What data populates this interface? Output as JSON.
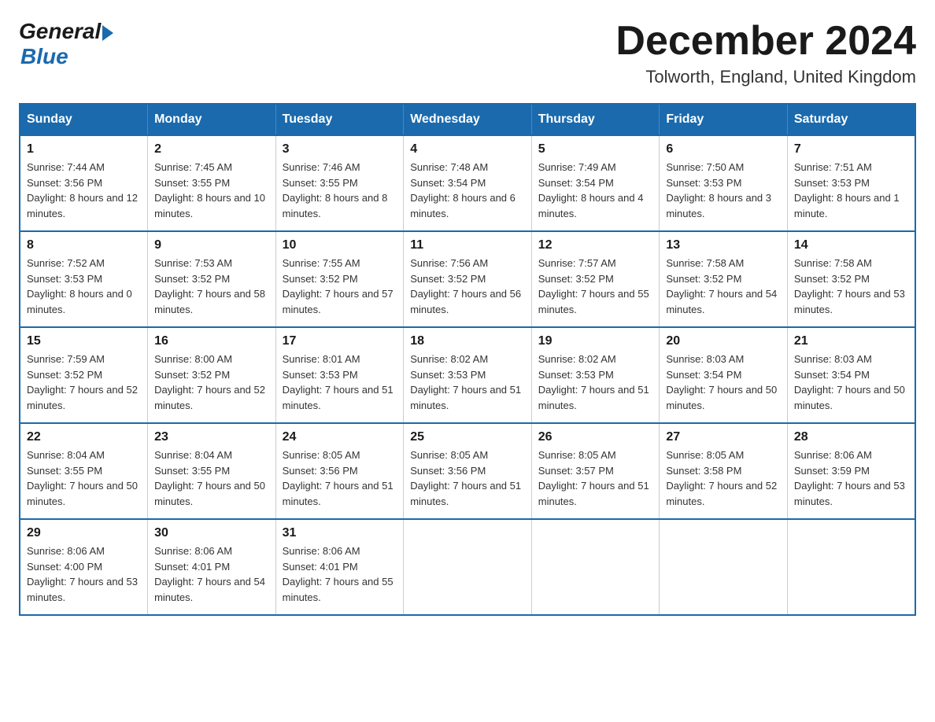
{
  "header": {
    "logo_general": "General",
    "logo_blue": "Blue",
    "month_title": "December 2024",
    "location": "Tolworth, England, United Kingdom"
  },
  "weekdays": [
    "Sunday",
    "Monday",
    "Tuesday",
    "Wednesday",
    "Thursday",
    "Friday",
    "Saturday"
  ],
  "weeks": [
    [
      {
        "day": "1",
        "sunrise": "7:44 AM",
        "sunset": "3:56 PM",
        "daylight": "8 hours and 12 minutes."
      },
      {
        "day": "2",
        "sunrise": "7:45 AM",
        "sunset": "3:55 PM",
        "daylight": "8 hours and 10 minutes."
      },
      {
        "day": "3",
        "sunrise": "7:46 AM",
        "sunset": "3:55 PM",
        "daylight": "8 hours and 8 minutes."
      },
      {
        "day": "4",
        "sunrise": "7:48 AM",
        "sunset": "3:54 PM",
        "daylight": "8 hours and 6 minutes."
      },
      {
        "day": "5",
        "sunrise": "7:49 AM",
        "sunset": "3:54 PM",
        "daylight": "8 hours and 4 minutes."
      },
      {
        "day": "6",
        "sunrise": "7:50 AM",
        "sunset": "3:53 PM",
        "daylight": "8 hours and 3 minutes."
      },
      {
        "day": "7",
        "sunrise": "7:51 AM",
        "sunset": "3:53 PM",
        "daylight": "8 hours and 1 minute."
      }
    ],
    [
      {
        "day": "8",
        "sunrise": "7:52 AM",
        "sunset": "3:53 PM",
        "daylight": "8 hours and 0 minutes."
      },
      {
        "day": "9",
        "sunrise": "7:53 AM",
        "sunset": "3:52 PM",
        "daylight": "7 hours and 58 minutes."
      },
      {
        "day": "10",
        "sunrise": "7:55 AM",
        "sunset": "3:52 PM",
        "daylight": "7 hours and 57 minutes."
      },
      {
        "day": "11",
        "sunrise": "7:56 AM",
        "sunset": "3:52 PM",
        "daylight": "7 hours and 56 minutes."
      },
      {
        "day": "12",
        "sunrise": "7:57 AM",
        "sunset": "3:52 PM",
        "daylight": "7 hours and 55 minutes."
      },
      {
        "day": "13",
        "sunrise": "7:58 AM",
        "sunset": "3:52 PM",
        "daylight": "7 hours and 54 minutes."
      },
      {
        "day": "14",
        "sunrise": "7:58 AM",
        "sunset": "3:52 PM",
        "daylight": "7 hours and 53 minutes."
      }
    ],
    [
      {
        "day": "15",
        "sunrise": "7:59 AM",
        "sunset": "3:52 PM",
        "daylight": "7 hours and 52 minutes."
      },
      {
        "day": "16",
        "sunrise": "8:00 AM",
        "sunset": "3:52 PM",
        "daylight": "7 hours and 52 minutes."
      },
      {
        "day": "17",
        "sunrise": "8:01 AM",
        "sunset": "3:53 PM",
        "daylight": "7 hours and 51 minutes."
      },
      {
        "day": "18",
        "sunrise": "8:02 AM",
        "sunset": "3:53 PM",
        "daylight": "7 hours and 51 minutes."
      },
      {
        "day": "19",
        "sunrise": "8:02 AM",
        "sunset": "3:53 PM",
        "daylight": "7 hours and 51 minutes."
      },
      {
        "day": "20",
        "sunrise": "8:03 AM",
        "sunset": "3:54 PM",
        "daylight": "7 hours and 50 minutes."
      },
      {
        "day": "21",
        "sunrise": "8:03 AM",
        "sunset": "3:54 PM",
        "daylight": "7 hours and 50 minutes."
      }
    ],
    [
      {
        "day": "22",
        "sunrise": "8:04 AM",
        "sunset": "3:55 PM",
        "daylight": "7 hours and 50 minutes."
      },
      {
        "day": "23",
        "sunrise": "8:04 AM",
        "sunset": "3:55 PM",
        "daylight": "7 hours and 50 minutes."
      },
      {
        "day": "24",
        "sunrise": "8:05 AM",
        "sunset": "3:56 PM",
        "daylight": "7 hours and 51 minutes."
      },
      {
        "day": "25",
        "sunrise": "8:05 AM",
        "sunset": "3:56 PM",
        "daylight": "7 hours and 51 minutes."
      },
      {
        "day": "26",
        "sunrise": "8:05 AM",
        "sunset": "3:57 PM",
        "daylight": "7 hours and 51 minutes."
      },
      {
        "day": "27",
        "sunrise": "8:05 AM",
        "sunset": "3:58 PM",
        "daylight": "7 hours and 52 minutes."
      },
      {
        "day": "28",
        "sunrise": "8:06 AM",
        "sunset": "3:59 PM",
        "daylight": "7 hours and 53 minutes."
      }
    ],
    [
      {
        "day": "29",
        "sunrise": "8:06 AM",
        "sunset": "4:00 PM",
        "daylight": "7 hours and 53 minutes."
      },
      {
        "day": "30",
        "sunrise": "8:06 AM",
        "sunset": "4:01 PM",
        "daylight": "7 hours and 54 minutes."
      },
      {
        "day": "31",
        "sunrise": "8:06 AM",
        "sunset": "4:01 PM",
        "daylight": "7 hours and 55 minutes."
      },
      null,
      null,
      null,
      null
    ]
  ]
}
